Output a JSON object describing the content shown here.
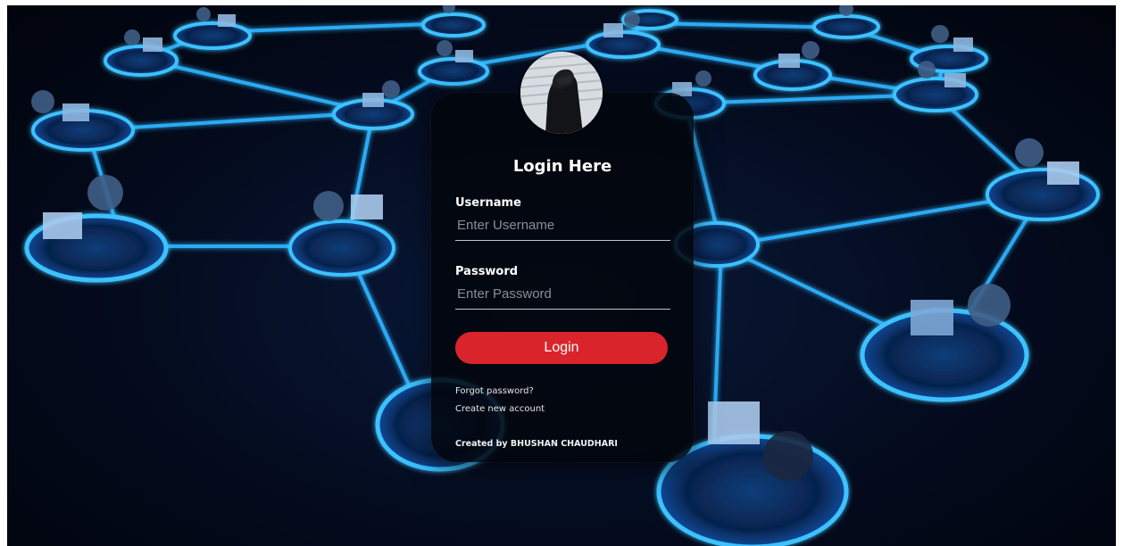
{
  "login": {
    "title": "Login Here",
    "username_label": "Username",
    "username_placeholder": "Enter Username",
    "username_value": "",
    "password_label": "Password",
    "password_placeholder": "Enter Password",
    "password_value": "",
    "login_button": "Login",
    "forgot_password": "Forgot password?",
    "create_account": "Create new account",
    "credit": "Created by BHUSHAN CHAUDHARI"
  },
  "colors": {
    "card_background": "#02060c",
    "button": "#d9242c",
    "network_glow": "#1aa3ff"
  },
  "icons": {
    "avatar": "profile-avatar-icon",
    "background": "network-illustration"
  }
}
